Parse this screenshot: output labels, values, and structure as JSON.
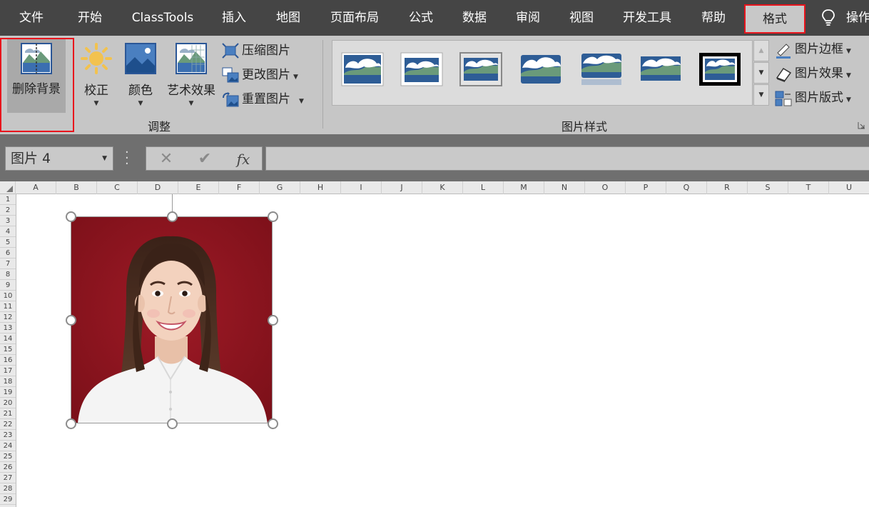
{
  "tabs": [
    {
      "label": "文件"
    },
    {
      "label": "开始"
    },
    {
      "label": "ClassTools"
    },
    {
      "label": "插入"
    },
    {
      "label": "地图"
    },
    {
      "label": "页面布局"
    },
    {
      "label": "公式"
    },
    {
      "label": "数据"
    },
    {
      "label": "审阅"
    },
    {
      "label": "视图"
    },
    {
      "label": "开发工具"
    },
    {
      "label": "帮助"
    },
    {
      "label": "格式"
    },
    {
      "label": "操作"
    }
  ],
  "ribbon": {
    "remove_bg": "删除背景",
    "corrections": "校正",
    "color": "颜色",
    "artistic": "艺术效果",
    "compress": "压缩图片",
    "change": "更改图片",
    "reset": "重置图片",
    "group_adjust": "调整",
    "group_styles": "图片样式",
    "border": "图片边框",
    "effects": "图片效果",
    "layout": "图片版式"
  },
  "formula_bar": {
    "name_box": "图片 4",
    "fx": "fx"
  },
  "columns": [
    "A",
    "B",
    "C",
    "D",
    "E",
    "F",
    "G",
    "H",
    "I",
    "J",
    "K",
    "L",
    "M",
    "N",
    "O",
    "P",
    "Q",
    "R",
    "S",
    "T",
    "U"
  ],
  "rows": [
    "1",
    "2",
    "3",
    "4",
    "5",
    "6",
    "7",
    "8",
    "9",
    "10",
    "11",
    "12",
    "13",
    "14",
    "15",
    "16",
    "17",
    "18",
    "19",
    "20",
    "21",
    "22",
    "23",
    "24",
    "25",
    "26",
    "27",
    "28",
    "29"
  ],
  "colors": {
    "menu_bg": "#454545",
    "ribbon_bg": "#c6c6c6",
    "highlight": "#e8141c",
    "photo_bg": "#8c1420"
  }
}
